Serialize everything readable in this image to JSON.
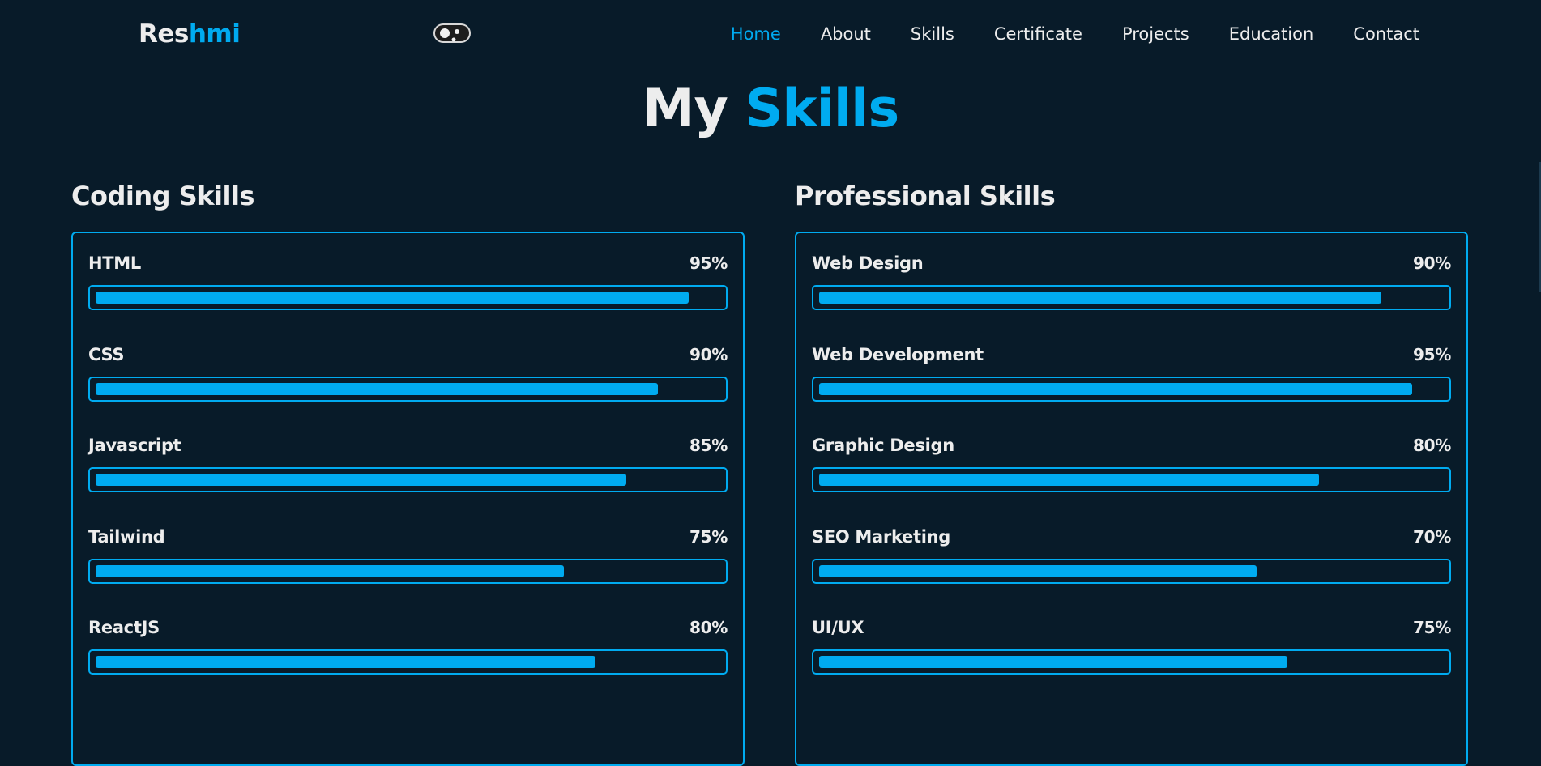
{
  "header": {
    "logo_main": "Res",
    "logo_accent": "hmi",
    "toggle_icon": "theme-toggle-icon",
    "nav": [
      {
        "label": "Home",
        "active": true
      },
      {
        "label": "About",
        "active": false
      },
      {
        "label": "Skills",
        "active": false
      },
      {
        "label": "Certificate",
        "active": false
      },
      {
        "label": "Projects",
        "active": false
      },
      {
        "label": "Education",
        "active": false
      },
      {
        "label": "Contact",
        "active": false
      }
    ]
  },
  "heading": {
    "main": "My",
    "accent": "Skills"
  },
  "coding": {
    "title": "Coding Skills",
    "skills": [
      {
        "name": "HTML",
        "percent_label": "95%",
        "percent": 95
      },
      {
        "name": "CSS",
        "percent_label": "90%",
        "percent": 90
      },
      {
        "name": "Javascript",
        "percent_label": "85%",
        "percent": 85
      },
      {
        "name": "Tailwind",
        "percent_label": "75%",
        "percent": 75
      },
      {
        "name": "ReactJS",
        "percent_label": "80%",
        "percent": 80
      }
    ]
  },
  "professional": {
    "title": "Professional Skills",
    "skills": [
      {
        "name": "Web Design",
        "percent_label": "90%",
        "percent": 90
      },
      {
        "name": "Web Development",
        "percent_label": "95%",
        "percent": 95
      },
      {
        "name": "Graphic Design",
        "percent_label": "80%",
        "percent": 80
      },
      {
        "name": "SEO Marketing",
        "percent_label": "70%",
        "percent": 70
      },
      {
        "name": "UI/UX",
        "percent_label": "75%",
        "percent": 75
      }
    ]
  },
  "colors": {
    "background": "#081b29",
    "accent": "#00abf0",
    "text": "#ededed"
  }
}
